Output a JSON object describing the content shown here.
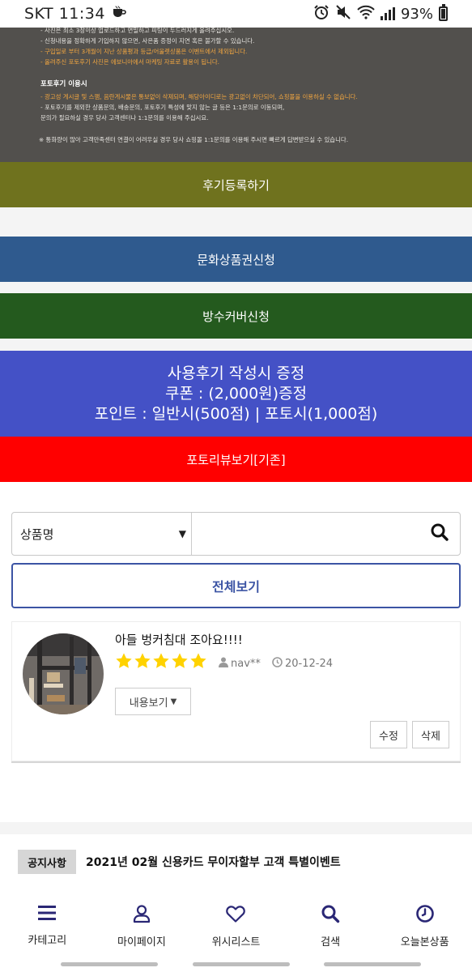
{
  "status_bar": {
    "carrier_time": "SKT 11:34",
    "battery": "93%",
    "icons": [
      "coffee-icon",
      "alarm-icon",
      "mute-icon",
      "wifi-icon",
      "signal-icon",
      "battery-icon"
    ]
  },
  "notice": {
    "lines_top": [
      {
        "text": "- 사진은 최소 3장이상 업로드하고 면밀하고 피팅이 두드러지게 올려주십시오.",
        "highlight": false
      },
      {
        "text": "- 신청내용을 정확하게 기입하지 않으면, 사은품 증정이 지연 혹은 불가할 수 있습니다.",
        "highlight": false
      },
      {
        "text": "- 구입일로 부터 3개월이 지난 상품평과 등급/어울렛상품은 이벤트에서 제외됩니다.",
        "highlight": true
      },
      {
        "text": "- 올려주신 포토후기 사진은 에보니아에서 마케팅 자료로 활용이 됩니다.",
        "highlight": false
      }
    ],
    "usage_title": "포토후기 이용시",
    "usage_lines": [
      {
        "text": "- 광고성 게시글 및 스팸, 음란게시물은 통보없이 삭제되며, 해당아이디로는 광고없이 차단되어, 쇼핑몰을 이용하실 수 없습니다.",
        "highlight": true
      },
      {
        "text": "- 포토후기를 제외한 상품문의, 배송문의, 포토후기 특성에 맞지 않는 글 등은 1:1문의로 이동되며,",
        "highlight": false
      },
      {
        "text": "  문의가 필요하실 경우 당사 고객센터나 1:1문의를 이용해 주십시요.",
        "highlight": false
      }
    ],
    "footer": "※ 통화량이 많아 고객만족센터 연결이 어려우실 경우 당사 쇼핑몰 1:1문의를 이용해 주시면 빠르게 답변받으실 수 있습니다."
  },
  "buttons": {
    "review_register": "후기등록하기",
    "culture_voucher": "문화상품권신청",
    "waterproof_cover": "방수커버신청",
    "promo_line1": "사용후기 작성시 증정",
    "promo_line2": "쿠폰 : (2,000원)증정",
    "promo_line3": "포인트 : 일반시(500점) | 포토시(1,000점)",
    "photo_review_old": "포토리뷰보기[기존]"
  },
  "search": {
    "select_value": "상품명",
    "input_value": "",
    "placeholder": ""
  },
  "view_all": "전체보기",
  "review": {
    "title": "아들 벙커침대 조아요!!!!",
    "rating": 5,
    "author": "nav**",
    "date": "20-12-24",
    "content_button": "내용보기",
    "edit_button": "수정",
    "delete_button": "삭제"
  },
  "ticker": {
    "label": "공지사항",
    "text": "2021년 02월 신용카드 무이자할부 고객 특별이벤트"
  },
  "bottom_nav": [
    {
      "label": "카테고리",
      "icon": "menu-icon"
    },
    {
      "label": "마이페이지",
      "icon": "user-icon"
    },
    {
      "label": "위시리스트",
      "icon": "heart-icon"
    },
    {
      "label": "검색",
      "icon": "search-icon"
    },
    {
      "label": "오늘본상품",
      "icon": "clock-icon"
    }
  ],
  "colors": {
    "review_register": "#6f721e",
    "culture_voucher": "#2f5a8e",
    "waterproof_cover": "#245a1e",
    "promo": "#4451c6",
    "photo_review": "#ff0000",
    "accent": "#3c54a4",
    "star": "#ffd200",
    "nav_icon": "#2a2775"
  }
}
